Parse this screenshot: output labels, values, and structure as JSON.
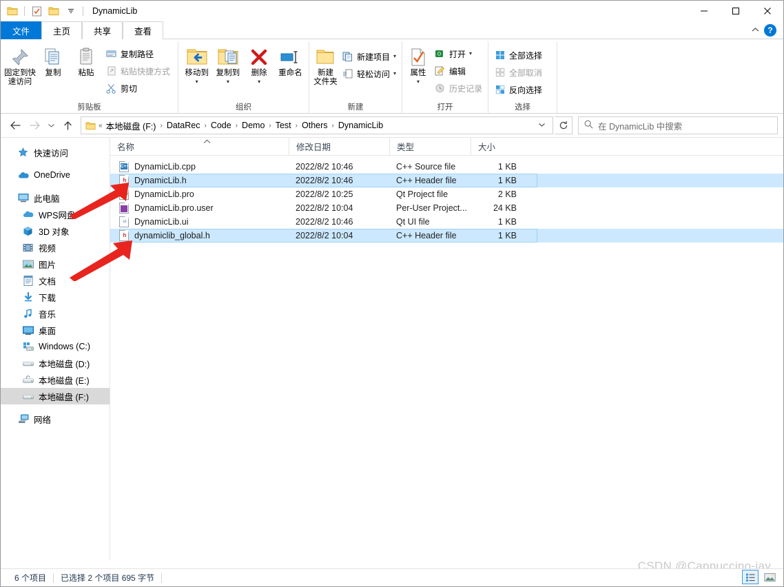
{
  "window": {
    "title": "DynamicLib",
    "quick_access": [
      {
        "name": "qat-folder-icon",
        "label": "属性"
      },
      {
        "name": "qat-properties-icon",
        "label": "属性"
      },
      {
        "name": "qat-new-folder-icon",
        "label": "新建文件夹"
      },
      {
        "name": "qat-customize-icon",
        "label": "自定义快速访问工具栏"
      }
    ],
    "controls": {
      "minimize": "—",
      "maximize": "□",
      "close": "✕"
    }
  },
  "tabs": [
    {
      "label": "文件",
      "active_file": true
    },
    {
      "label": "主页",
      "active_file": false
    },
    {
      "label": "共享",
      "active_file": false
    },
    {
      "label": "查看",
      "active_file": false
    }
  ],
  "tab_right": {
    "collapse_icon": "chevron-up-icon",
    "help_label": "?"
  },
  "ribbon": {
    "groups": [
      {
        "label": "剪贴板",
        "big_buttons": [
          {
            "label1": "固定到快",
            "label2": "速访问",
            "icon": "pin-icon"
          },
          {
            "label1": "复制",
            "label2": "",
            "icon": "copy-icon"
          },
          {
            "label1": "粘贴",
            "label2": "",
            "icon": "paste-icon"
          }
        ],
        "small_buttons": [
          {
            "label": "复制路径",
            "icon": "copy-path-icon",
            "disabled": false
          },
          {
            "label": "粘贴快捷方式",
            "icon": "paste-shortcut-icon",
            "disabled": true
          },
          {
            "label": "剪切",
            "icon": "scissors-icon",
            "disabled": false
          }
        ]
      },
      {
        "label": "组织",
        "big_buttons": [
          {
            "label1": "移动到",
            "label2": "",
            "icon": "move-to-icon",
            "caret": true
          },
          {
            "label1": "复制到",
            "label2": "",
            "icon": "copy-to-icon",
            "caret": true
          },
          {
            "label1": "删除",
            "label2": "",
            "icon": "delete-icon",
            "caret": true
          },
          {
            "label1": "重命名",
            "label2": "",
            "icon": "rename-icon",
            "caret": false
          }
        ],
        "small_buttons": []
      },
      {
        "label": "新建",
        "big_buttons": [
          {
            "label1": "新建",
            "label2": "文件夹",
            "icon": "new-folder-icon",
            "caret": false
          }
        ],
        "small_buttons": [
          {
            "label": "新建项目",
            "icon": "new-item-icon",
            "caret": true
          },
          {
            "label": "轻松访问",
            "icon": "easy-access-icon",
            "caret": true
          }
        ]
      },
      {
        "label": "打开",
        "big_buttons": [
          {
            "label1": "属性",
            "label2": "",
            "icon": "properties-icon",
            "caret": true
          }
        ],
        "small_buttons": [
          {
            "label": "打开",
            "icon": "open-icon",
            "caret": true,
            "disabled": false
          },
          {
            "label": "编辑",
            "icon": "edit-icon",
            "caret": false,
            "disabled": false
          },
          {
            "label": "历史记录",
            "icon": "history-icon",
            "caret": false,
            "disabled": true
          }
        ]
      },
      {
        "label": "选择",
        "big_buttons": [],
        "small_buttons": [
          {
            "label": "全部选择",
            "icon": "select-all-icon",
            "disabled": false
          },
          {
            "label": "全部取消",
            "icon": "select-none-icon",
            "disabled": true
          },
          {
            "label": "反向选择",
            "icon": "invert-selection-icon",
            "disabled": false
          }
        ]
      }
    ]
  },
  "addressbar": {
    "back_icon": "arrow-left-icon",
    "forward_icon": "arrow-right-icon",
    "recent_icon": "chevron-down-icon",
    "up_icon": "arrow-up-icon",
    "overflow": "«",
    "breadcrumbs": [
      "本地磁盘 (F:)",
      "DataRec",
      "Code",
      "Demo",
      "Test",
      "Others",
      "DynamicLib"
    ],
    "separator": "›",
    "dropdown_icon": "chevron-down-icon",
    "refresh_icon": "refresh-icon"
  },
  "search": {
    "placeholder": "在 DynamicLib 中搜索",
    "icon": "search-icon"
  },
  "sidebar": {
    "items": [
      {
        "label": "快速访问",
        "icon": "star-pin-icon",
        "indent": false,
        "selected": false,
        "gap_after": true
      },
      {
        "label": "OneDrive",
        "icon": "onedrive-cloud-icon",
        "indent": false,
        "selected": false,
        "gap_after": true
      },
      {
        "label": "此电脑",
        "icon": "this-pc-icon",
        "indent": false,
        "selected": false,
        "gap_after": false
      },
      {
        "label": "WPS网盘",
        "icon": "wps-cloud-icon",
        "indent": true,
        "selected": false,
        "gap_after": false
      },
      {
        "label": "3D 对象",
        "icon": "3d-objects-icon",
        "indent": true,
        "selected": false,
        "gap_after": false
      },
      {
        "label": "视频",
        "icon": "videos-icon",
        "indent": true,
        "selected": false,
        "gap_after": false
      },
      {
        "label": "图片",
        "icon": "pictures-icon",
        "indent": true,
        "selected": false,
        "gap_after": false
      },
      {
        "label": "文档",
        "icon": "documents-icon",
        "indent": true,
        "selected": false,
        "gap_after": false
      },
      {
        "label": "下载",
        "icon": "downloads-icon",
        "indent": true,
        "selected": false,
        "gap_after": false
      },
      {
        "label": "音乐",
        "icon": "music-icon",
        "indent": true,
        "selected": false,
        "gap_after": false
      },
      {
        "label": "桌面",
        "icon": "desktop-icon",
        "indent": true,
        "selected": false,
        "gap_after": false
      },
      {
        "label": "Windows (C:)",
        "icon": "system-drive-icon",
        "indent": true,
        "selected": false,
        "gap_after": false
      },
      {
        "label": "本地磁盘 (D:)",
        "icon": "drive-icon",
        "indent": true,
        "selected": false,
        "gap_after": false
      },
      {
        "label": "本地磁盘 (E:)",
        "icon": "drive-locked-icon",
        "indent": true,
        "selected": false,
        "gap_after": false
      },
      {
        "label": "本地磁盘 (F:)",
        "icon": "drive-icon",
        "indent": true,
        "selected": true,
        "gap_after": true
      },
      {
        "label": "网络",
        "icon": "network-icon",
        "indent": false,
        "selected": false,
        "gap_after": false
      }
    ]
  },
  "filelist": {
    "columns": [
      {
        "label": "名称",
        "key": "name"
      },
      {
        "label": "修改日期",
        "key": "date"
      },
      {
        "label": "类型",
        "key": "type"
      },
      {
        "label": "大小",
        "key": "size"
      }
    ],
    "sort_indicator": "^",
    "rows": [
      {
        "name": "DynamicLib.cpp",
        "date": "2022/8/2 10:46",
        "type": "C++ Source file",
        "size": "1 KB",
        "selected": false,
        "icon": "cpp-file-icon",
        "tag": "C++",
        "tagcolor": "#1f6fb5"
      },
      {
        "name": "DynamicLib.h",
        "date": "2022/8/2 10:46",
        "type": "C++ Header file",
        "size": "1 KB",
        "selected": true,
        "icon": "header-file-icon",
        "tag": "h",
        "tagcolor": "#cc2e2e"
      },
      {
        "name": "DynamicLib.pro",
        "date": "2022/8/2 10:25",
        "type": "Qt Project file",
        "size": "2 KB",
        "selected": false,
        "icon": "qt-project-file-icon",
        "tag": "pro",
        "tagcolor": "#62a83f"
      },
      {
        "name": "DynamicLib.pro.user",
        "date": "2022/8/2 10:04",
        "type": "Per-User Project...",
        "size": "24 KB",
        "selected": false,
        "icon": "per-user-project-file-icon",
        "tag": "",
        "tagcolor": "#8a3fa8"
      },
      {
        "name": "DynamicLib.ui",
        "date": "2022/8/2 10:46",
        "type": "Qt UI file",
        "size": "1 KB",
        "selected": false,
        "icon": "qt-ui-file-icon",
        "tag": "ui",
        "tagcolor": "#7fa8c4"
      },
      {
        "name": "dynamiclib_global.h",
        "date": "2022/8/2 10:04",
        "type": "C++ Header file",
        "size": "1 KB",
        "selected": true,
        "icon": "header-file-icon",
        "tag": "h",
        "tagcolor": "#cc2e2e"
      }
    ]
  },
  "statusbar": {
    "item_count": "6 个项目",
    "selection": "已选择 2 个项目  695 字节"
  },
  "viewbuttons": [
    {
      "name": "details-view-button",
      "active": true
    },
    {
      "name": "large-icons-view-button",
      "active": false
    }
  ],
  "watermark": {
    "text": "CSDN @Cappuccino-jay"
  },
  "annotations": {
    "arrow_color": "#e8241f",
    "arrows": [
      {
        "name": "annotation-arrow-dynamiclib-h"
      },
      {
        "name": "annotation-arrow-dynamiclib-global-h"
      }
    ]
  },
  "colors": {
    "accent": "#0078d7",
    "selection": "#cce8ff",
    "nav_selection": "#d9d9d9",
    "annotation_red": "#e8241f"
  }
}
